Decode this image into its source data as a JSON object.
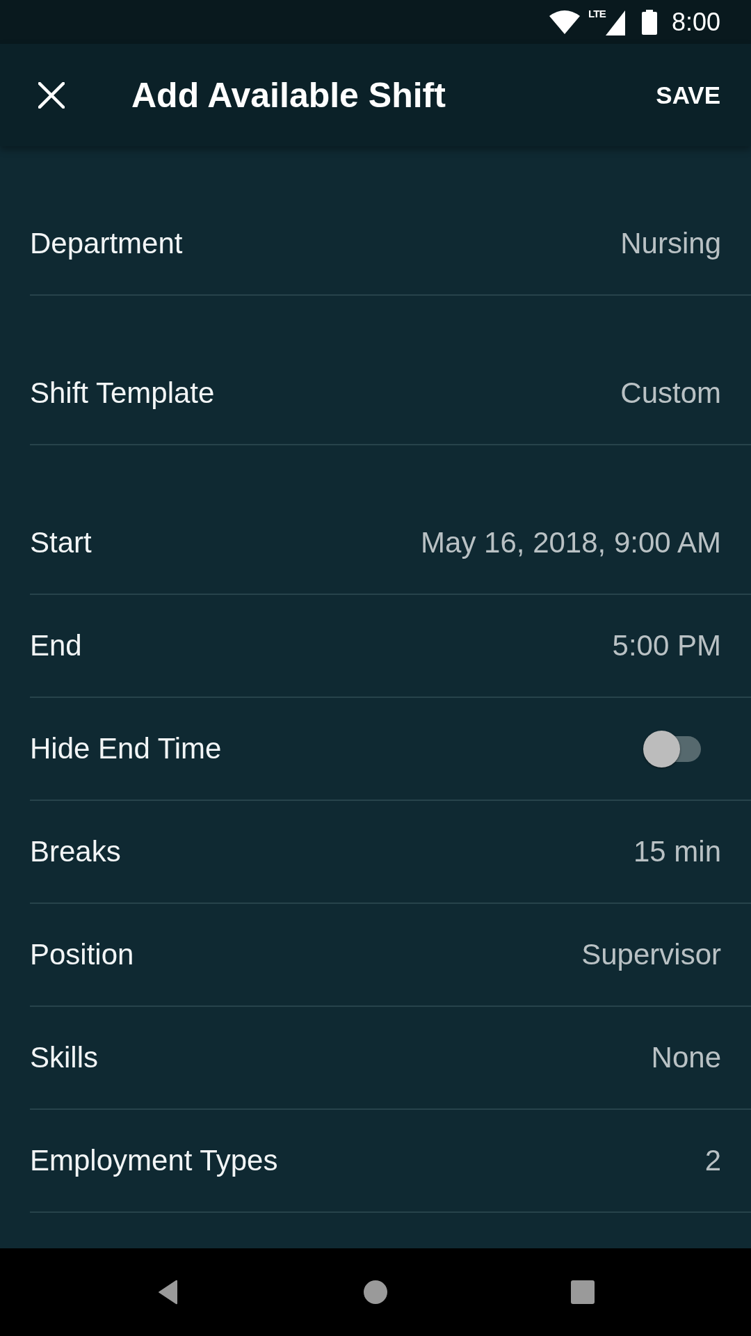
{
  "status_bar": {
    "network_type": "LTE",
    "time": "8:00"
  },
  "app_bar": {
    "title": "Add Available Shift",
    "action": "SAVE"
  },
  "sections": [
    {
      "rows": [
        {
          "kind": "value",
          "label": "Department",
          "value": "Nursing"
        }
      ]
    },
    {
      "rows": [
        {
          "kind": "value",
          "label": "Shift Template",
          "value": "Custom"
        }
      ]
    },
    {
      "rows": [
        {
          "kind": "value",
          "label": "Start",
          "value": "May 16, 2018, 9:00 AM"
        },
        {
          "kind": "value",
          "label": "End",
          "value": "5:00 PM"
        },
        {
          "kind": "switch",
          "label": "Hide End Time",
          "on": false
        },
        {
          "kind": "value",
          "label": "Breaks",
          "value": "15 min"
        },
        {
          "kind": "value",
          "label": "Position",
          "value": "Supervisor"
        },
        {
          "kind": "value",
          "label": "Skills",
          "value": "None"
        },
        {
          "kind": "value",
          "label": "Employment Types",
          "value": "2"
        }
      ]
    }
  ]
}
